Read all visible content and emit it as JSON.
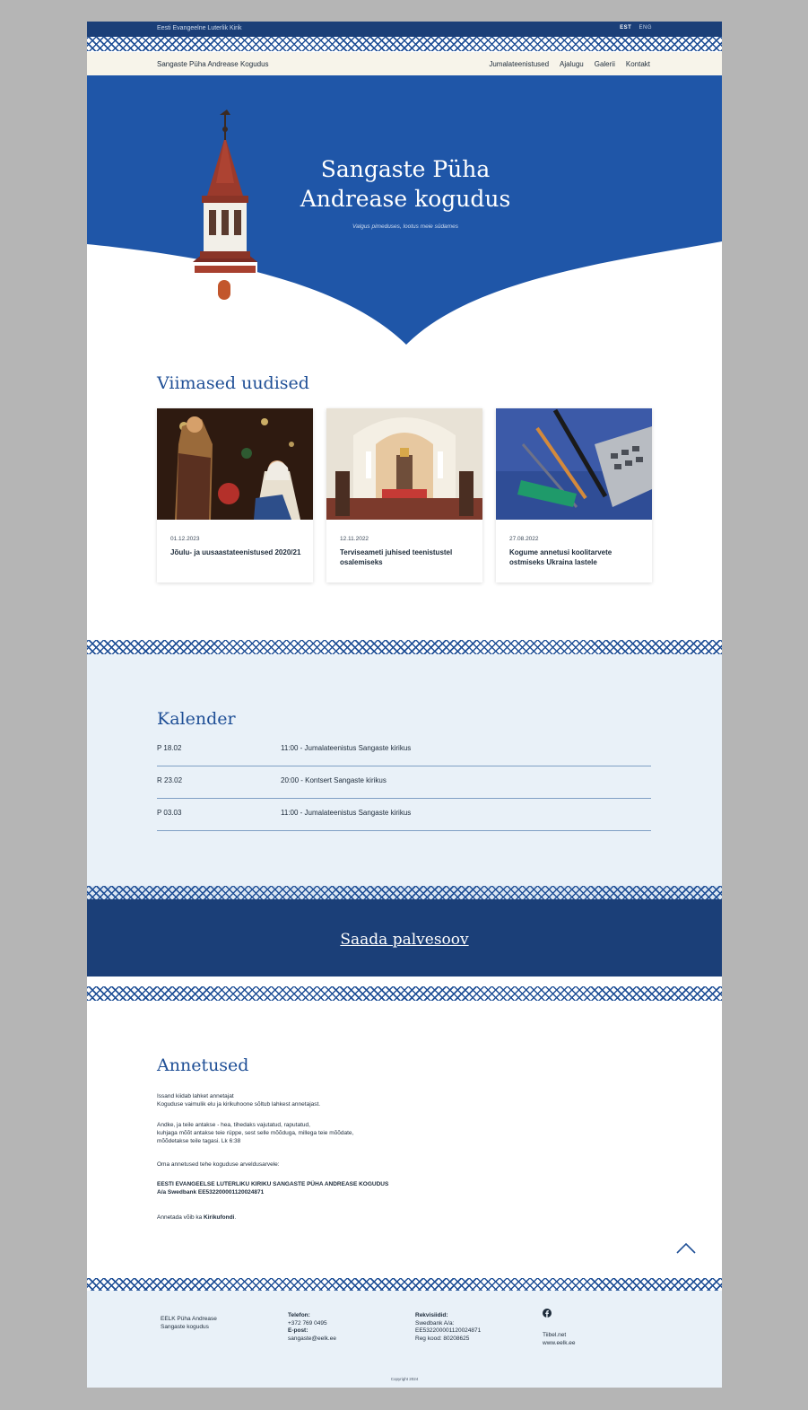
{
  "topbar": {
    "org": "Eesti Evangeelne Luterlik Kirik",
    "lang_active": "EST",
    "lang_other": "ENG"
  },
  "nav": {
    "site_name": "Sangaste Püha Andrease Kogudus",
    "items": [
      "Jumalateenistused",
      "Ajalugu",
      "Galerii",
      "Kontakt"
    ]
  },
  "hero": {
    "title_line1": "Sangaste Püha",
    "title_line2": "Andrease kogudus",
    "subtitle": "Valgus pimeduses, lootus meie südames"
  },
  "news": {
    "heading": "Viimased uudised",
    "items": [
      {
        "date": "01.12.2023",
        "title": "Jõulu- ja uusaastateenistused 2020/21"
      },
      {
        "date": "12.11.2022",
        "title": "Terviseameti juhised teenistustel osalemiseks"
      },
      {
        "date": "27.08.2022",
        "title": "Kogume annetusi koolitarvete ostmiseks Ukraina lastele"
      }
    ]
  },
  "calendar": {
    "heading": "Kalender",
    "rows": [
      {
        "day": "P 18.02",
        "event": "11:00 - Jumalateenistus Sangaste kirikus"
      },
      {
        "day": "R 23.02",
        "event": "20:00 - Kontsert Sangaste kirikus"
      },
      {
        "day": "P 03.03",
        "event": "11:00 - Jumalateenistus Sangaste kirikus"
      }
    ]
  },
  "cta": {
    "label": "Saada palvesoov"
  },
  "donations": {
    "heading": "Annetused",
    "p1_line1": "Issand kiidab lahket annetajat",
    "p1_line2": "Koguduse vaimulik elu ja kirikuhoone sõltub lahkest annetajast.",
    "p2_line1": "Andke, ja teile antakse - hea, tihedaks vajutatud, raputatud,",
    "p2_line2": "kuhjaga mõõt antakse teie rüppe, sest selle mõõduga, millega teie mõõdate,",
    "p2_line3": "mõõdetakse teile tagasi. Lk 6:38",
    "p3": "Oma annetused tehe koguduse arveldusarvele:",
    "account_name": "EESTI EVANGEELSE LUTERLIKU KIRIKU SANGASTE PÜHA ANDREASE KOGUDUS",
    "account_number": "A/a Swedbank EE532200001120024871",
    "p5_text": "Annetada võib ka ",
    "p5_link": "Kirikufondi",
    "p5_end": "."
  },
  "footer": {
    "org_line1": "EELK Püha Andrease",
    "org_line2": "Sangaste kogudus",
    "phone_label": "Telefon:",
    "phone": "+372 769 0495",
    "email_label": "E-post:",
    "email": "sangaste@eelk.ee",
    "req_label": "Rekvisiidid:",
    "req_bank": "Swedbank A/a:",
    "req_account": "EE532200001120024871",
    "req_code": "Reg kood: 80208625",
    "link1": "Tiibel.net",
    "link2": "www.eelk.ee",
    "copyright": "Copyright 2024"
  },
  "colors": {
    "brand_blue": "#1f4f96",
    "dark_blue": "#1b3f78",
    "light_bg": "#e9f1f8",
    "nav_bg": "#f7f4ea"
  },
  "icons": {
    "social": "facebook-icon",
    "scroll": "chevron-up-icon"
  }
}
